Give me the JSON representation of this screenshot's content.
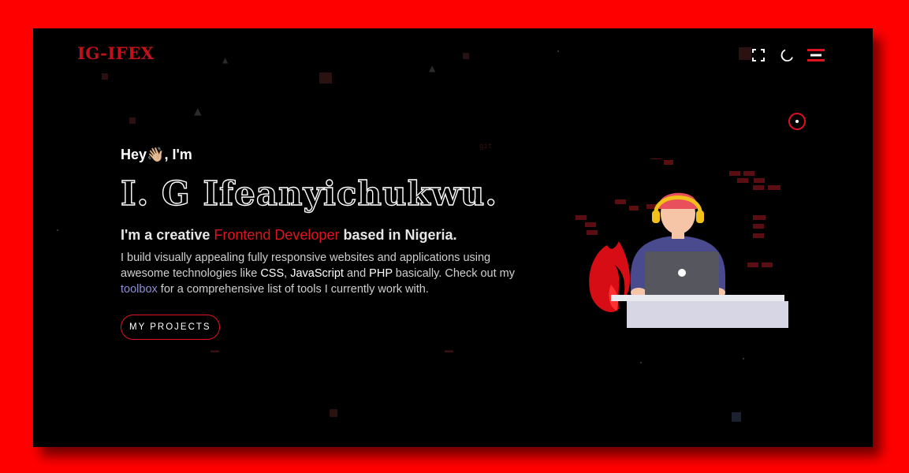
{
  "brand": {
    "logo": "IG-IFEX"
  },
  "nav": {
    "icons": [
      "blank-tile-icon",
      "fullscreen-icon",
      "moon-icon",
      "menu-icon"
    ]
  },
  "hero": {
    "greeting_prefix": "Hey",
    "greeting_emoji": "👋🏼",
    "greeting_suffix": ", I'm",
    "name": "I. G Ifeanyichukwu.",
    "tagline_prefix": "I'm a creative ",
    "tagline_accent": "Frontend Developer",
    "tagline_suffix": " based in Nigeria.",
    "desc_part1": "I build visually appealing fully responsive websites and applications using awesome technologies like ",
    "tech_css": "CSS",
    "desc_sep1": ", ",
    "tech_js": "JavaScript",
    "desc_sep2": " and ",
    "tech_php": "PHP",
    "desc_part2": " basically. Check out my ",
    "toolbox_link": "toolbox",
    "desc_part3": " for a comprehensive list of tools I currently work with.",
    "cta_label": "MY PROJECTS"
  },
  "colors": {
    "accent": "#e0141f",
    "background": "#000000",
    "frame": "#ff0000",
    "link": "#8f8fd6"
  }
}
